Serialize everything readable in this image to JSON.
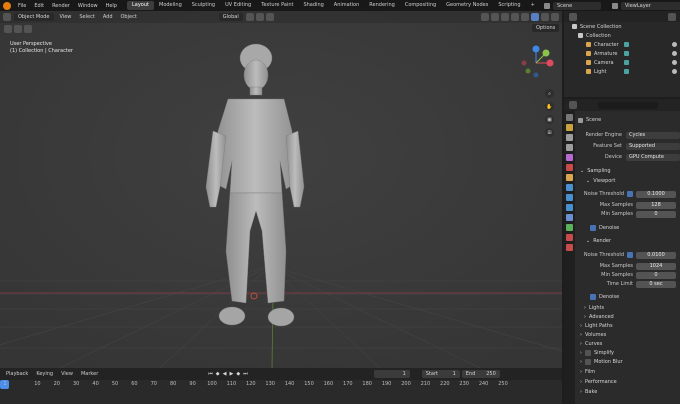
{
  "menu": {
    "items": [
      "File",
      "Edit",
      "Render",
      "Window",
      "Help"
    ],
    "workspaces": [
      "Layout",
      "Modeling",
      "Sculpting",
      "UV Editing",
      "Texture Paint",
      "Shading",
      "Animation",
      "Rendering",
      "Compositing",
      "Geometry Nodes",
      "Scripting"
    ],
    "active_workspace": "Layout",
    "add_tab": "+",
    "scene_name": "Scene",
    "view_layer": "ViewLayer"
  },
  "viewport": {
    "mode": "Object Mode",
    "menus": [
      "View",
      "Select",
      "Add",
      "Object"
    ],
    "transform": "Global",
    "perspective": "User Perspective",
    "collection_info": "(1) Collection | Character",
    "options": "Options",
    "gizmo": {
      "x": "X",
      "y": "Y",
      "z": "Z"
    }
  },
  "outliner": {
    "root": "Scene Collection",
    "collection": "Collection",
    "objects": [
      {
        "name": "Character",
        "color": "#d9a64f"
      },
      {
        "name": "Armature",
        "color": "#d9a64f"
      },
      {
        "name": "Camera",
        "color": "#d9a64f"
      },
      {
        "name": "Light",
        "color": "#d9a64f"
      }
    ]
  },
  "properties": {
    "header": "Scene",
    "render_engine_label": "Render Engine",
    "render_engine": "Cycles",
    "feature_set_label": "Feature Set",
    "feature_set": "Supported",
    "device_label": "Device",
    "device": "GPU Compute",
    "sampling": "Sampling",
    "viewport": "Viewport",
    "vp_noise_label": "Noise Threshold",
    "vp_noise": "0.1000",
    "vp_max_label": "Max Samples",
    "vp_max": "128",
    "vp_min_label": "Min Samples",
    "vp_min": "0",
    "vp_denoise": "Denoise",
    "render": "Render",
    "r_noise_label": "Noise Threshold",
    "r_noise": "0.0100",
    "r_max_label": "Max Samples",
    "r_max": "1024",
    "r_min_label": "Min Samples",
    "r_min": "0",
    "r_time_label": "Time Limit",
    "r_time": "0 sec",
    "r_denoise": "Denoise",
    "lights": "Lights",
    "advanced": "Advanced",
    "light_paths": "Light Paths",
    "volumes": "Volumes",
    "curves": "Curves",
    "simplify": "Simplify",
    "motion_blur": "Motion Blur",
    "film": "Film",
    "performance": "Performance",
    "bake": "Bake"
  },
  "timeline": {
    "menus": [
      "Playback",
      "Keying",
      "View",
      "Marker"
    ],
    "current_frame": "1",
    "start_label": "Start",
    "start": "1",
    "end_label": "End",
    "end": "250",
    "ticks": [
      "1",
      "10",
      "20",
      "30",
      "40",
      "50",
      "60",
      "70",
      "80",
      "90",
      "100",
      "110",
      "120",
      "130",
      "140",
      "150",
      "160",
      "170",
      "180",
      "190",
      "200",
      "210",
      "220",
      "230",
      "240",
      "250"
    ]
  },
  "colors": {
    "accent_blue": "#4772b3",
    "gizmo_x": "#e04a5f",
    "gizmo_y": "#8bc34a",
    "gizmo_z": "#3f88e6",
    "playhead": "#4c8ee8"
  }
}
